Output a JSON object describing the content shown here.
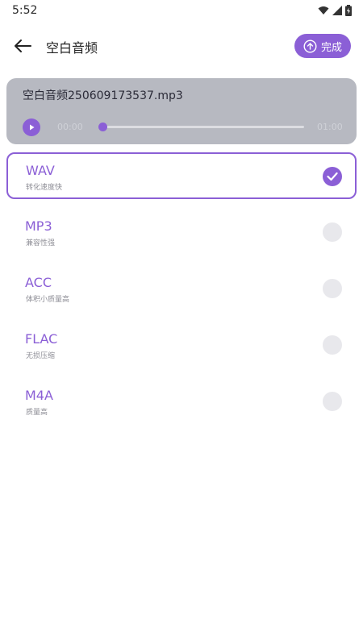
{
  "status": {
    "time": "5:52"
  },
  "header": {
    "title": "空白音频",
    "done_label": "完成"
  },
  "player": {
    "file_name": "空白音频250609173537.mp3",
    "current_time": "00:00",
    "total_time": "01:00",
    "progress": 0
  },
  "formats": [
    {
      "name": "WAV",
      "desc": "转化速度快",
      "selected": true
    },
    {
      "name": "MP3",
      "desc": "兼容性强",
      "selected": false
    },
    {
      "name": "ACC",
      "desc": "体积小质量高",
      "selected": false
    },
    {
      "name": "FLAC",
      "desc": "无损压缩",
      "selected": false
    },
    {
      "name": "M4A",
      "desc": "质量高",
      "selected": false
    }
  ],
  "colors": {
    "accent": "#8b5fd6",
    "player_bg": "#b7b9c1"
  }
}
